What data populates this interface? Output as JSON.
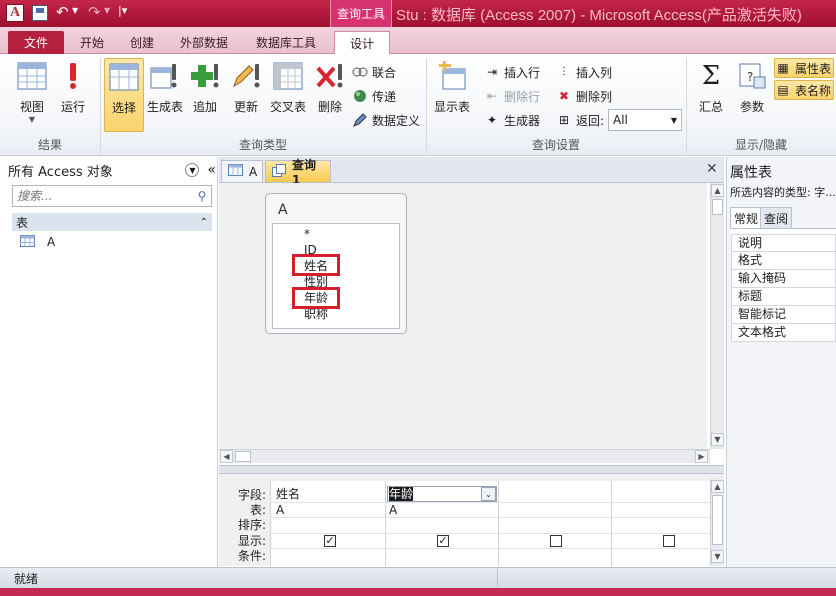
{
  "titlebar": {
    "app_icon": "A",
    "undo_icon": "↶",
    "redo_icon": "↷",
    "context_tab": "查询工具",
    "window_title": "Stu : 数据库 (Access 2007) - Microsoft Access(产品激活失败)"
  },
  "tabs": [
    "文件",
    "开始",
    "创建",
    "外部数据",
    "数据库工具",
    "设计"
  ],
  "ribbon": {
    "results": {
      "view": "视图",
      "run": "运行",
      "label": "结果"
    },
    "query_type": {
      "select": "选择",
      "make_table": "生成表",
      "append": "追加",
      "update": "更新",
      "crosstab": "交叉表",
      "delete": "删除",
      "union": "联合",
      "passthrough": "传递",
      "data_definition": "数据定义",
      "label": "查询类型"
    },
    "query_setup": {
      "show_table": "显示表",
      "insert_rows": "插入行",
      "delete_rows": "删除行",
      "builder": "生成器",
      "insert_columns": "插入列",
      "delete_columns": "删除列",
      "return": "返回:",
      "return_value": "All",
      "label": "查询设置"
    },
    "show_hide": {
      "totals": "汇总",
      "parameters": "参数",
      "property_sheet": "属性表",
      "table_names": "表名称",
      "label": "显示/隐藏"
    }
  },
  "nav": {
    "header": "所有 Access 对象",
    "search_placeholder": "搜索...",
    "group": "表",
    "items": [
      "A"
    ]
  },
  "doc_tabs": [
    "A",
    "查询1"
  ],
  "design": {
    "table_name": "A",
    "fields": [
      "*",
      "ID",
      "姓名",
      "性别",
      "年龄",
      "职称"
    ]
  },
  "qbe": {
    "row_labels": [
      "字段:",
      "表:",
      "排序:",
      "显示:",
      "条件:"
    ],
    "columns": [
      {
        "field": "姓名",
        "table": "A",
        "show": true
      },
      {
        "field": "年龄",
        "table": "A",
        "show": true
      },
      {
        "field": "",
        "table": "",
        "show": false
      },
      {
        "field": "",
        "table": "",
        "show": false
      }
    ]
  },
  "property_sheet": {
    "title": "属性表",
    "subtitle": "所选内容的类型: 字...",
    "tabs": [
      "常规",
      "查阅"
    ],
    "rows": [
      "说明",
      "格式",
      "输入掩码",
      "标题",
      "智能标记",
      "文本格式"
    ]
  },
  "status": "就绪",
  "colors": {
    "title_bar": "#b01838",
    "highlight_box": "#d61e2d",
    "selected_button": "#f9d46c"
  }
}
